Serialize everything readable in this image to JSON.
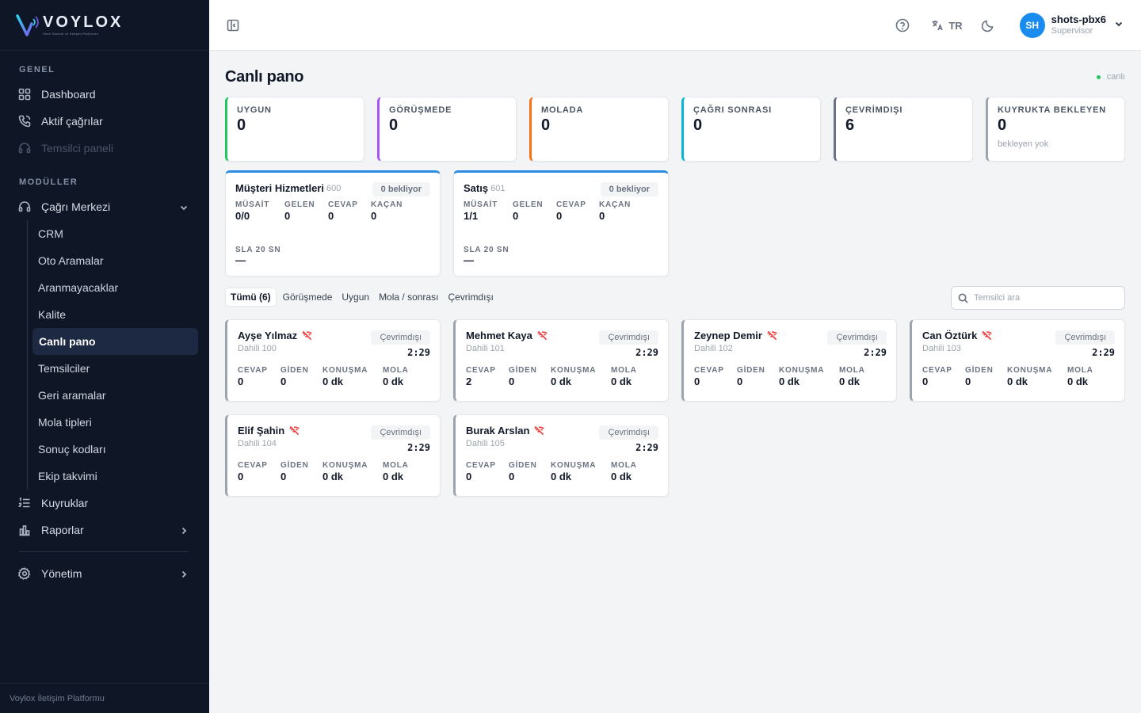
{
  "brand": {
    "name": "VOYLOX",
    "tagline": "Sesli Santral ve İletişim Platformu",
    "footer": "Voylox İletişim Platformu"
  },
  "sidebar": {
    "section_general": "GENEL",
    "section_modules": "MODÜLLER",
    "general": [
      {
        "label": "Dashboard",
        "icon": "grid-icon"
      },
      {
        "label": "Aktif çağrılar",
        "icon": "phone-icon"
      },
      {
        "label": "Temsilci paneli",
        "icon": "headset-icon",
        "disabled": true
      }
    ],
    "call_center": {
      "label": "Çağrı Merkezi",
      "icon": "headset-icon",
      "expanded": true
    },
    "sub_items": [
      "CRM",
      "Oto Aramalar",
      "Aranmayacaklar",
      "Kalite",
      "Canlı pano",
      "Temsilciler",
      "Geri aramalar",
      "Mola tipleri",
      "Sonuç kodları",
      "Ekip takvimi"
    ],
    "active_sub": "Canlı pano",
    "queues_label": "Kuyruklar",
    "reports_label": "Raporlar",
    "admin_label": "Yönetim"
  },
  "topbar": {
    "lang": "TR",
    "avatar_initials": "SH",
    "user_name": "shots-pbx6",
    "user_role": "Supervisor"
  },
  "page": {
    "title": "Canlı pano",
    "live_label": "canlı"
  },
  "stats": [
    {
      "label": "UYGUN",
      "value": "0",
      "color": "#22c55e"
    },
    {
      "label": "GÖRÜŞMEDE",
      "value": "0",
      "color": "#a855f7"
    },
    {
      "label": "MOLADA",
      "value": "0",
      "color": "#f97316"
    },
    {
      "label": "ÇAĞRI SONRASI",
      "value": "0",
      "color": "#06b6d4"
    },
    {
      "label": "ÇEVRİMDIŞI",
      "value": "6",
      "color": "#6b7280"
    },
    {
      "label": "KUYRUKTA BEKLEYEN",
      "value": "0",
      "sub": "bekleyen yok",
      "color": "#9ca3af"
    }
  ],
  "queues": [
    {
      "name": "Müşteri Hizmetleri",
      "number": "600",
      "badge": "0 bekliyor",
      "metrics": [
        {
          "label": "MÜSAİT",
          "value": "0/0"
        },
        {
          "label": "GELEN",
          "value": "0"
        },
        {
          "label": "CEVAP",
          "value": "0"
        },
        {
          "label": "KAÇAN",
          "value": "0"
        }
      ],
      "sla_label": "SLA 20 SN",
      "sla_value": "—"
    },
    {
      "name": "Satış",
      "number": "601",
      "badge": "0 bekliyor",
      "metrics": [
        {
          "label": "MÜSAİT",
          "value": "1/1"
        },
        {
          "label": "GELEN",
          "value": "0"
        },
        {
          "label": "CEVAP",
          "value": "0"
        },
        {
          "label": "KAÇAN",
          "value": "0"
        }
      ],
      "sla_label": "SLA 20 SN",
      "sla_value": "—"
    }
  ],
  "filters": [
    "Tümü (6)",
    "Görüşmede",
    "Uygun",
    "Mola / sonrası",
    "Çevrimdışı"
  ],
  "search": {
    "placeholder": "Temsilci ara"
  },
  "agent_metric_labels": [
    "CEVAP",
    "GİDEN",
    "KONUŞMA",
    "MOLA"
  ],
  "agents": [
    {
      "name": "Ayşe Yılmaz",
      "ext": "Dahili 100",
      "status": "Çevrimdışı",
      "time": "2:29",
      "values": [
        "0",
        "0",
        "0 dk",
        "0 dk"
      ]
    },
    {
      "name": "Mehmet Kaya",
      "ext": "Dahili 101",
      "status": "Çevrimdışı",
      "time": "2:29",
      "values": [
        "2",
        "0",
        "0 dk",
        "0 dk"
      ]
    },
    {
      "name": "Zeynep Demir",
      "ext": "Dahili 102",
      "status": "Çevrimdışı",
      "time": "2:29",
      "values": [
        "0",
        "0",
        "0 dk",
        "0 dk"
      ]
    },
    {
      "name": "Can Öztürk",
      "ext": "Dahili 103",
      "status": "Çevrimdışı",
      "time": "2:29",
      "values": [
        "0",
        "0",
        "0 dk",
        "0 dk"
      ]
    },
    {
      "name": "Elif Şahin",
      "ext": "Dahili 104",
      "status": "Çevrimdışı",
      "time": "2:29",
      "values": [
        "0",
        "0",
        "0 dk",
        "0 dk"
      ]
    },
    {
      "name": "Burak Arslan",
      "ext": "Dahili 105",
      "status": "Çevrimdışı",
      "time": "2:29",
      "values": [
        "0",
        "0",
        "0 dk",
        "0 dk"
      ]
    }
  ]
}
